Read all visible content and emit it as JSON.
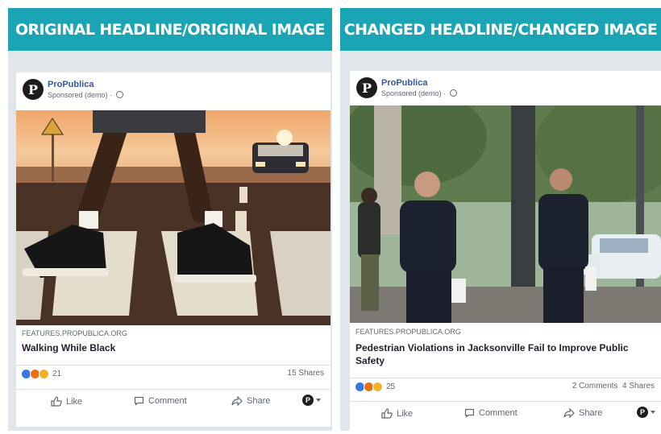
{
  "left": {
    "banner": "ORIGINAL HEADLINE/ORIGINAL IMAGE",
    "page_name": "ProPublica",
    "sponsored": "Sponsored (demo) ·",
    "domain": "FEATURES.PROPUBLICA.ORG",
    "headline": "Walking While Black",
    "reaction_count": "21",
    "engagement": "15 Shares",
    "actions": {
      "like": "Like",
      "comment": "Comment",
      "share": "Share"
    },
    "logo_letter": "P"
  },
  "right": {
    "banner": "CHANGED HEADLINE/CHANGED IMAGE",
    "page_name": "ProPublica",
    "sponsored": "Sponsored (demo) ·",
    "domain": "FEATURES.PROPUBLICA.ORG",
    "headline": "Pedestrian Violations in Jacksonville Fail to Improve Public Safety",
    "reaction_count": "25",
    "engagement": "2 Comments  4 Shares",
    "actions": {
      "like": "Like",
      "comment": "Comment",
      "share": "Share"
    },
    "logo_letter": "P"
  },
  "colors": {
    "banner": "#1ba5b4",
    "link": "#365899",
    "background": "#e1e6ea"
  }
}
